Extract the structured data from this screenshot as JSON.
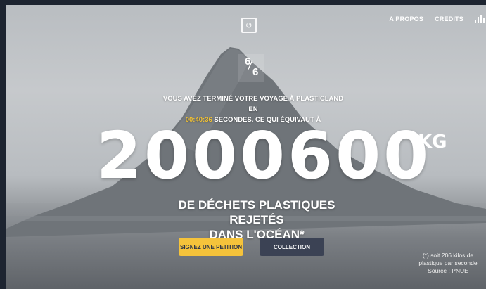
{
  "nav": {
    "about_label": "A PROPOS",
    "credits_label": "CREDITS"
  },
  "icons": {
    "logo": "logo-icon",
    "sound": "sound-bars-icon"
  },
  "progress": {
    "current": "6",
    "total": "6"
  },
  "intro": {
    "line1": "Vous avez terminé votre voyage à Plasticland en",
    "time": "00:40:36",
    "line2_suffix": "secondes. Ce qui équivaut à"
  },
  "result": {
    "amount": "2000600",
    "unit": "KG",
    "caption_line1": "DE DÉCHETS PLASTIQUES REJETÉS",
    "caption_line2": "DANS L'OCÉAN*"
  },
  "actions": {
    "petition_label": "SIGNEZ UNE PETITION",
    "collection_label": "COLLECTION"
  },
  "footnote": {
    "line1": "(*) soit 206 kilos de",
    "line2": "plastique par seconde",
    "line3": "Source : PNUE"
  },
  "colors": {
    "accent_yellow": "#f5c33b",
    "dark_button": "#3b4254",
    "time_highlight": "#f2c232"
  }
}
